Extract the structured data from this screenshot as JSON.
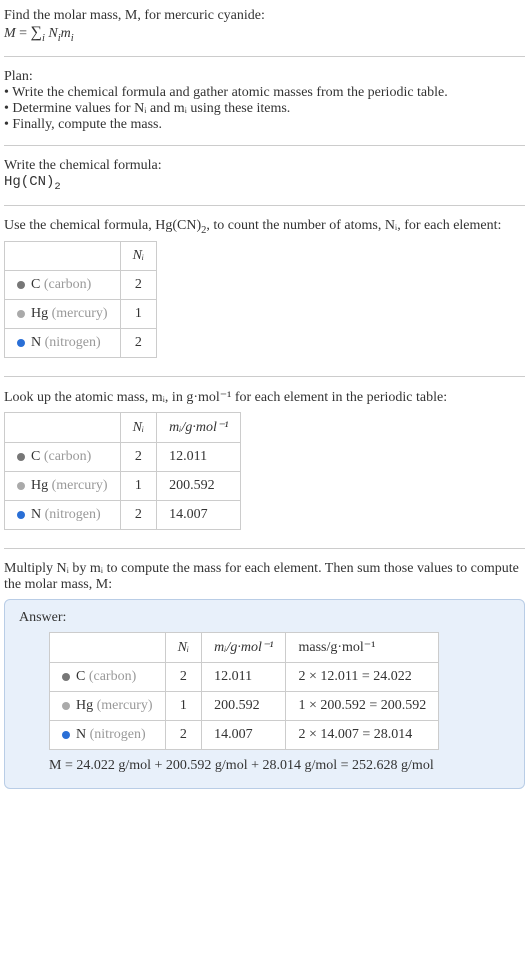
{
  "intro": {
    "l1": "Find the molar mass, M, for mercuric cyanide:",
    "l2_html": "M = ∑",
    "l2_sub": "i",
    "l2_tail": " Nᵢmᵢ"
  },
  "plan": {
    "title": "Plan:",
    "b1": "• Write the chemical formula and gather atomic masses from the periodic table.",
    "b2": "• Determine values for Nᵢ and mᵢ using these items.",
    "b3": "• Finally, compute the mass."
  },
  "write_formula": {
    "title": "Write the chemical formula:",
    "formula_base": "Hg(CN)",
    "formula_sub": "2"
  },
  "count": {
    "text_a": "Use the chemical formula, Hg(CN)",
    "text_sub": "2",
    "text_b": ", to count the number of atoms, Nᵢ, for each element:",
    "header_ni": "Nᵢ",
    "rows": [
      {
        "sym": "C",
        "name": "(carbon)",
        "ni": "2",
        "dot": "dot-c"
      },
      {
        "sym": "Hg",
        "name": "(mercury)",
        "ni": "1",
        "dot": "dot-hg"
      },
      {
        "sym": "N",
        "name": "(nitrogen)",
        "ni": "2",
        "dot": "dot-n"
      }
    ]
  },
  "lookup": {
    "text": "Look up the atomic mass, mᵢ, in g·mol⁻¹ for each element in the periodic table:",
    "header_ni": "Nᵢ",
    "header_mi": "mᵢ/g·mol⁻¹",
    "rows": [
      {
        "sym": "C",
        "name": "(carbon)",
        "ni": "2",
        "mi": "12.011",
        "dot": "dot-c"
      },
      {
        "sym": "Hg",
        "name": "(mercury)",
        "ni": "1",
        "mi": "200.592",
        "dot": "dot-hg"
      },
      {
        "sym": "N",
        "name": "(nitrogen)",
        "ni": "2",
        "mi": "14.007",
        "dot": "dot-n"
      }
    ]
  },
  "multiply": {
    "text": "Multiply Nᵢ by mᵢ to compute the mass for each element. Then sum those values to compute the molar mass, M:"
  },
  "answer": {
    "label": "Answer:",
    "header_ni": "Nᵢ",
    "header_mi": "mᵢ/g·mol⁻¹",
    "header_mass": "mass/g·mol⁻¹",
    "rows": [
      {
        "sym": "C",
        "name": "(carbon)",
        "ni": "2",
        "mi": "12.011",
        "mass": "2 × 12.011 = 24.022",
        "dot": "dot-c"
      },
      {
        "sym": "Hg",
        "name": "(mercury)",
        "ni": "1",
        "mi": "200.592",
        "mass": "1 × 200.592 = 200.592",
        "dot": "dot-hg"
      },
      {
        "sym": "N",
        "name": "(nitrogen)",
        "ni": "2",
        "mi": "14.007",
        "mass": "2 × 14.007 = 28.014",
        "dot": "dot-n"
      }
    ],
    "result": "M = 24.022 g/mol + 200.592 g/mol + 28.014 g/mol = 252.628 g/mol"
  }
}
